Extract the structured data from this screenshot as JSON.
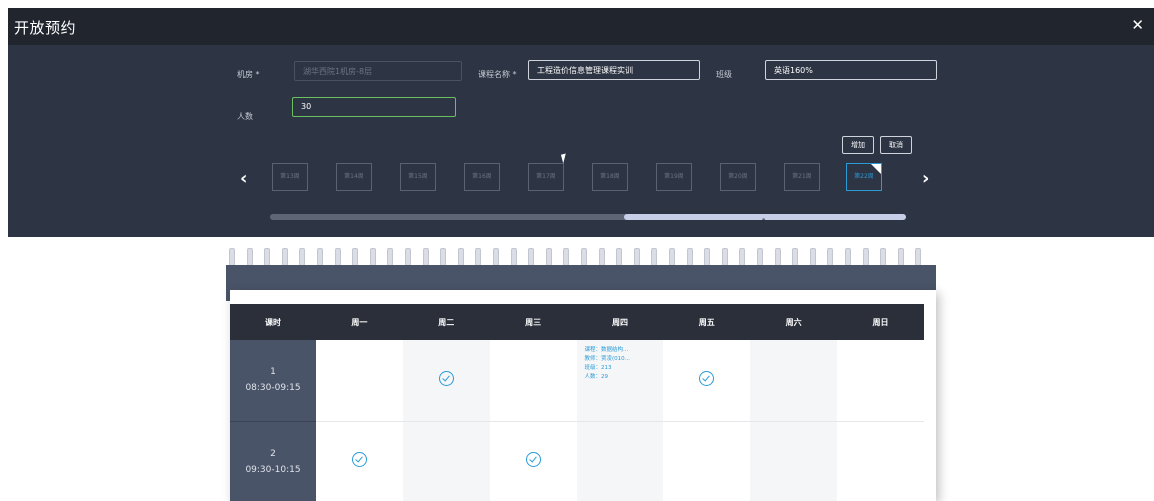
{
  "dialog": {
    "title": "开放预约",
    "close_icon": "✕"
  },
  "form": {
    "room_label": "机房 *",
    "room_value": "湖华西院1机房-8层",
    "course_label": "课程名称 *",
    "course_value": "工程造价信息管理课程实训",
    "class_label": "班级",
    "class_value": "英语160%",
    "count_label": "人数",
    "count_value": "30"
  },
  "buttons": {
    "add": "增加",
    "cancel": "取消"
  },
  "weeks": {
    "prev": "‹",
    "next": "›",
    "items": [
      "第13周",
      "第14周",
      "第15周",
      "第16周",
      "第17周",
      "第18周",
      "第19周",
      "第20周",
      "第21周",
      "第22周"
    ],
    "active": "第22周"
  },
  "scroll": {
    "grip": "III"
  },
  "schedule": {
    "headers": [
      "课时",
      "周一",
      "周二",
      "周三",
      "周四",
      "周五",
      "周六",
      "周日"
    ],
    "rows": [
      {
        "period": "1",
        "time": "08:30-09:15"
      },
      {
        "period": "2",
        "time": "09:30-10:15"
      }
    ],
    "booking": {
      "course": "课程：数据结构...",
      "teacher": "教师：贾凌(010...",
      "class": "班级：213",
      "count": "人数：29"
    }
  },
  "colors": {
    "dialog_bg": "#2d3443",
    "titlebar_bg": "#20252e",
    "accent": "#2a9bd6",
    "table_header": "#2b2f3a",
    "time_column": "#4a5468"
  }
}
